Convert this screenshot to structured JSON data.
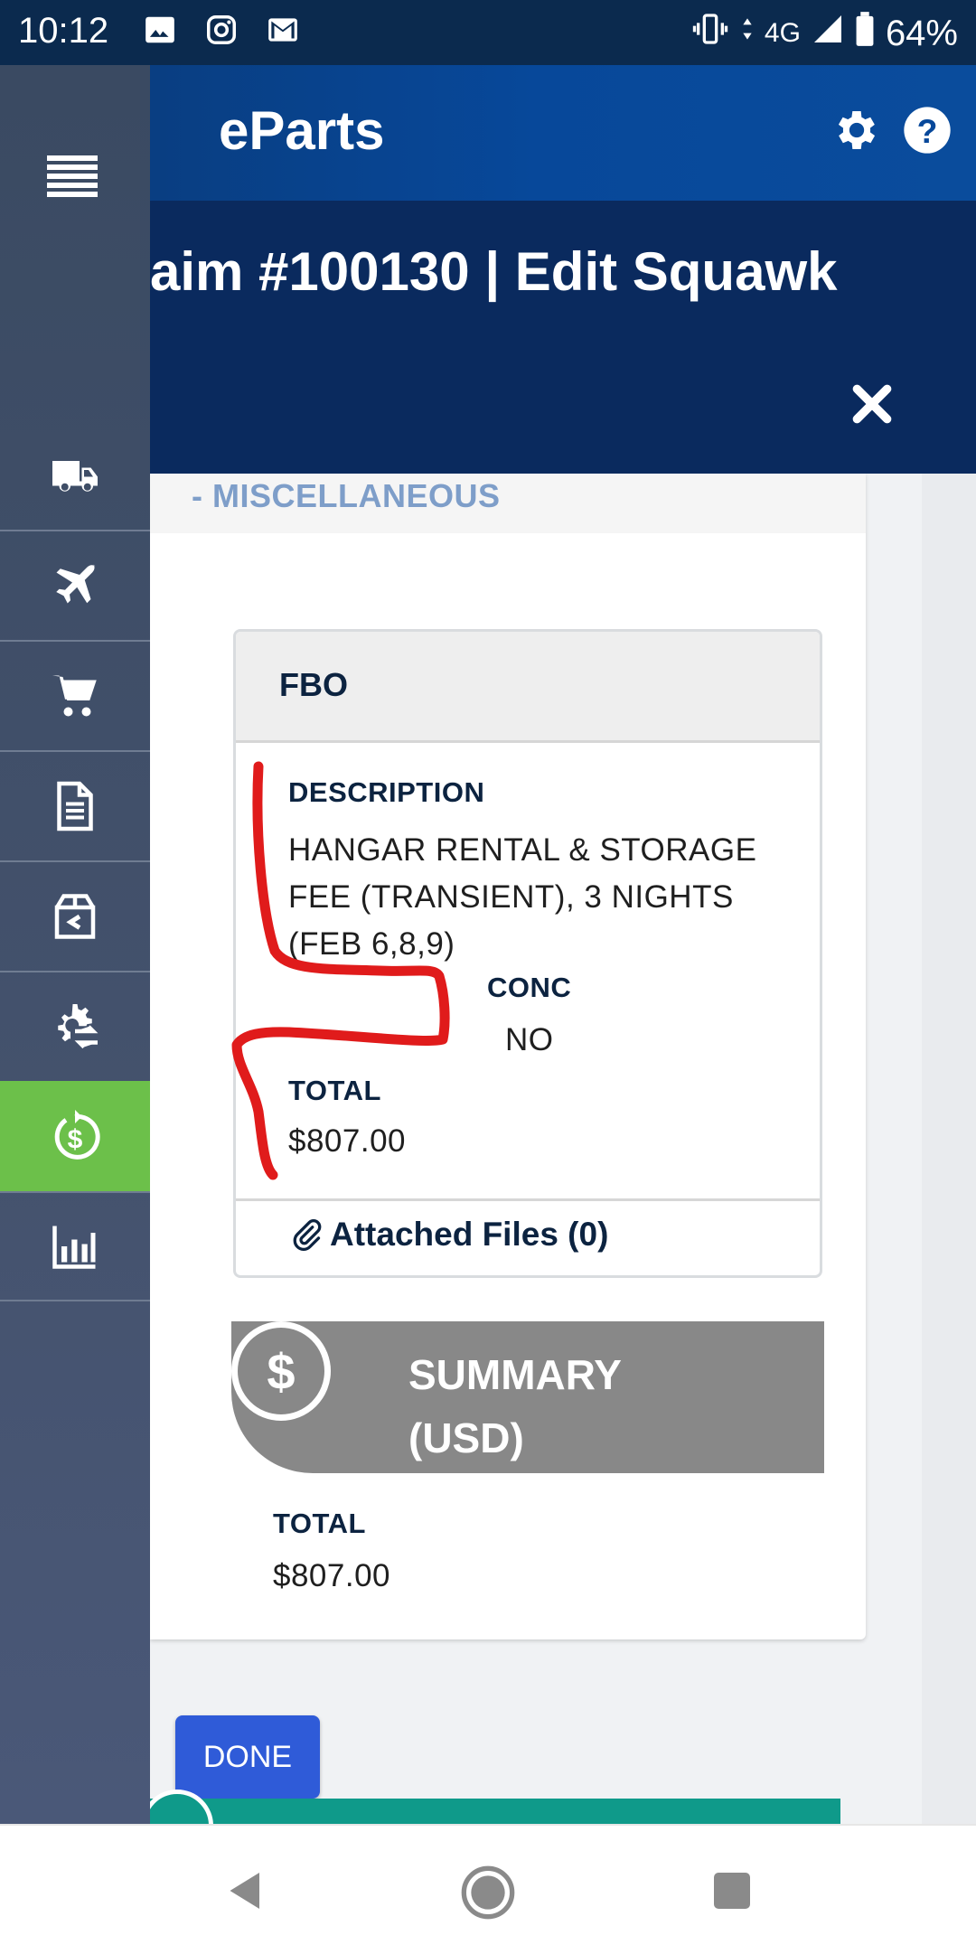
{
  "status_bar": {
    "time": "10:12",
    "network": "4G",
    "battery": "64%",
    "icons": [
      "gallery-icon",
      "instagram-icon",
      "gmail-icon",
      "vibrate-icon",
      "data-arrows-icon",
      "signal-icon",
      "battery-icon"
    ]
  },
  "header": {
    "app_title": "eParts",
    "icons": [
      "gear-icon",
      "help-icon"
    ]
  },
  "page": {
    "title": "aim #100130 | Edit Squawk",
    "close_icon": "close-icon"
  },
  "sidenav": {
    "items": [
      {
        "icon": "truck-icon",
        "active": false
      },
      {
        "icon": "airplane-icon",
        "active": false
      },
      {
        "icon": "cart-icon",
        "active": false
      },
      {
        "icon": "document-icon",
        "active": false
      },
      {
        "icon": "box-return-icon",
        "active": false
      },
      {
        "icon": "gear-exchange-icon",
        "active": false
      },
      {
        "icon": "dollar-refresh-icon",
        "active": true
      },
      {
        "icon": "bar-chart-icon",
        "active": false
      }
    ],
    "colors": {
      "active": "#6cc04a"
    }
  },
  "section": {
    "label": "- MISCELLANEOUS"
  },
  "fbo_card": {
    "title": "FBO",
    "description_label": "DESCRIPTION",
    "description_value": "HANGAR RENTAL & STORAGE FEE (TRANSIENT), 3 NIGHTS (FEB 6,8,9)",
    "conc_label": "CONC",
    "conc_value": "NO",
    "total_label": "TOTAL",
    "total_value": "$807.00",
    "attached_files": "Attached Files (0)"
  },
  "summary": {
    "icon_glyph": "$",
    "title_line1": "SUMMARY",
    "title_line2": "(USD)",
    "total_label": "TOTAL",
    "total_value": "$807.00"
  },
  "actions": {
    "done_label": "DONE"
  },
  "annotation": {
    "color": "#e01b1b"
  }
}
